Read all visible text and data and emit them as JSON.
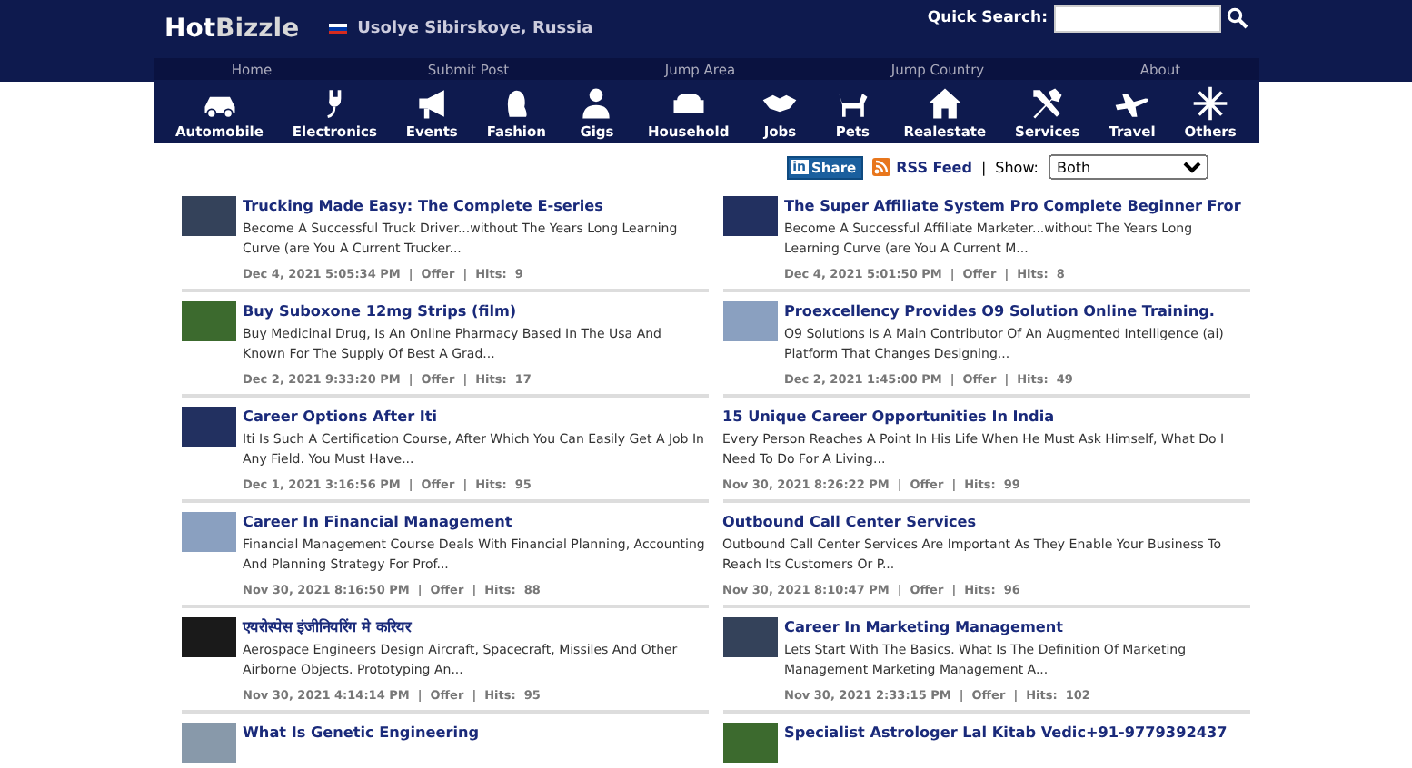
{
  "header": {
    "logo": {
      "part_1": "Hot",
      "part_2": "Bizzle"
    },
    "location": "Usolye Sibirskoye, Russia",
    "quick_search": {
      "label": "Quick Search:"
    }
  },
  "nav_links": [
    "Home",
    "Submit Post",
    "Jump Area",
    "Jump Country",
    "About"
  ],
  "categories": [
    "Automobile",
    "Electronics",
    "Events",
    "Fashion",
    "Gigs",
    "Household",
    "Jobs",
    "Pets",
    "Realestate",
    "Services",
    "Travel",
    "Others"
  ],
  "toolbar": {
    "share_logo": "in",
    "share": "Share",
    "rss": "RSS Feed",
    "separator": "|",
    "show_label": "Show:",
    "show_value": "Both"
  },
  "columns": [
    [
      {
        "title": "Trucking Made Easy: The Complete E-series",
        "thumbnail": true,
        "text": "Become A Successful Truck Driver...without The Years Long Learning Curve (are You A Current Trucker...",
        "meta": "Dec 4, 2021 5:05:34 PM  |  Offer  |  Hits:  9"
      },
      {
        "title": "Buy Suboxone 12mg Strips (film)",
        "thumbnail": true,
        "text": "Buy Medicinal Drug, Is An Online Pharmacy Based In The Usa And Known For The Supply Of Best A Grad...",
        "meta": "Dec 2, 2021 9:33:20 PM  |  Offer  |  Hits:  17"
      },
      {
        "title": "Career Options After Iti",
        "thumbnail": true,
        "text": "Iti Is Such A Certification Course, After Which You Can Easily Get A Job In Any Field. You Must Have...",
        "meta": "Dec 1, 2021 3:16:56 PM  |  Offer  |  Hits:  95"
      },
      {
        "title": "Career In Financial Management",
        "thumbnail": true,
        "text": "Financial Management Course Deals With Financial Planning, Accounting And Planning Strategy For Prof...",
        "meta": "Nov 30, 2021 8:16:50 PM  |  Offer  |  Hits:  88"
      },
      {
        "title": "एयरोस्पेस इंजीनियरिंग मे करियर",
        "thumbnail": true,
        "text": "Aerospace Engineers Design Aircraft, Spacecraft, Missiles And Other Airborne Objects. Prototyping An...",
        "meta": "Nov 30, 2021 4:14:14 PM  |  Offer  |  Hits:  95"
      },
      {
        "title": "What Is Genetic Engineering",
        "thumbnail": true
      }
    ],
    [
      {
        "title": "The Super Affiliate System Pro Complete Beginner Fror",
        "thumbnail": true,
        "text": "Become A Successful Affiliate Marketer...without The Years Long Learning Curve (are You A Current M...",
        "meta": "Dec 4, 2021 5:01:50 PM  |  Offer  |  Hits:  8"
      },
      {
        "title": "Proexcellency Provides O9 Solution Online Training.",
        "thumbnail": true,
        "text": "O9 Solutions Is A Main Contributor Of An Augmented Intelligence (ai) Platform That Changes Designing...",
        "meta": "Dec 2, 2021 1:45:00 PM  |  Offer  |  Hits:  49"
      },
      {
        "title": "15 Unique Career Opportunities In India",
        "thumbnail": false,
        "text": "Every Person Reaches A Point In His Life When He Must Ask Himself, What Do I Need To Do For A Living...",
        "meta": "Nov 30, 2021 8:26:22 PM  |  Offer  |  Hits:  99"
      },
      {
        "title": "Outbound Call Center Services",
        "thumbnail": false,
        "text": "Outbound Call Center Services Are Important As They Enable Your Business To Reach Its Customers Or P...",
        "meta": "Nov 30, 2021 8:10:47 PM  |  Offer  |  Hits:  96"
      },
      {
        "title": "Career In Marketing Management",
        "thumbnail": true,
        "text": "Lets Start With The Basics. What Is The Definition Of Marketing Management Marketing Management A...",
        "meta": "Nov 30, 2021 2:33:15 PM  |  Offer  |  Hits:  102"
      },
      {
        "title": "Specialist Astrologer Lal Kitab Vedic+91-9779392437",
        "thumbnail": true
      }
    ]
  ]
}
